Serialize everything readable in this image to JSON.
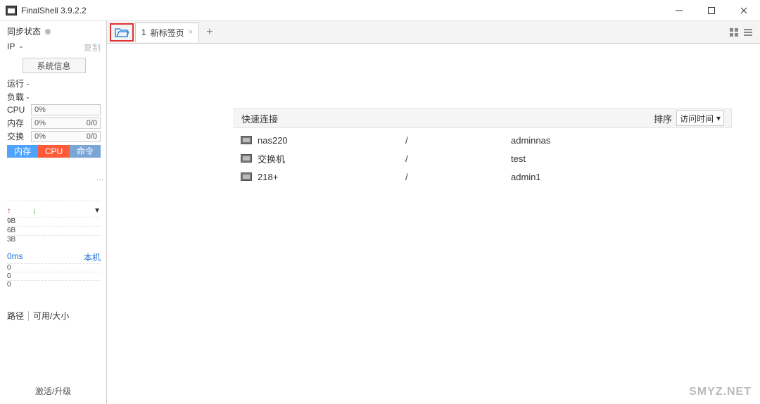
{
  "title": "FinalShell 3.9.2.2",
  "sidebar": {
    "sync_label": "同步状态",
    "ip_label": "IP",
    "ip_value": "-",
    "copy_label": "复制",
    "sysinfo_btn": "系统信息",
    "runtime_label": "运行",
    "runtime_value": "-",
    "load_label": "负载",
    "load_value": "-",
    "cpu_label": "CPU",
    "cpu_pct": "0%",
    "mem_label": "内存",
    "mem_pct": "0%",
    "mem_total": "0/0",
    "swap_label": "交换",
    "swap_pct": "0%",
    "swap_total": "0/0",
    "tabs": {
      "mem": "内存",
      "cpu": "CPU",
      "cmd": "命令"
    },
    "ticks": [
      "9B",
      "6B",
      "3B"
    ],
    "ping_ms": "0ms",
    "ping_host": "本机",
    "zeros": [
      "0",
      "0",
      "0"
    ],
    "path_label": "路径",
    "avail_label": "可用/大小",
    "activate": "激活/升级"
  },
  "tabbar": {
    "tab_index": "1",
    "tab_title": "新标签页"
  },
  "content": {
    "header": "快速连接",
    "sort_label": "排序",
    "sort_value": "访问时间",
    "rows": [
      {
        "name": "nas220",
        "path": "/",
        "user": "adminnas"
      },
      {
        "name": "交换机",
        "path": "/",
        "user": "test"
      },
      {
        "name": "218+",
        "path": "/",
        "user": "admin1"
      }
    ]
  },
  "watermark": "SMYZ.NET"
}
